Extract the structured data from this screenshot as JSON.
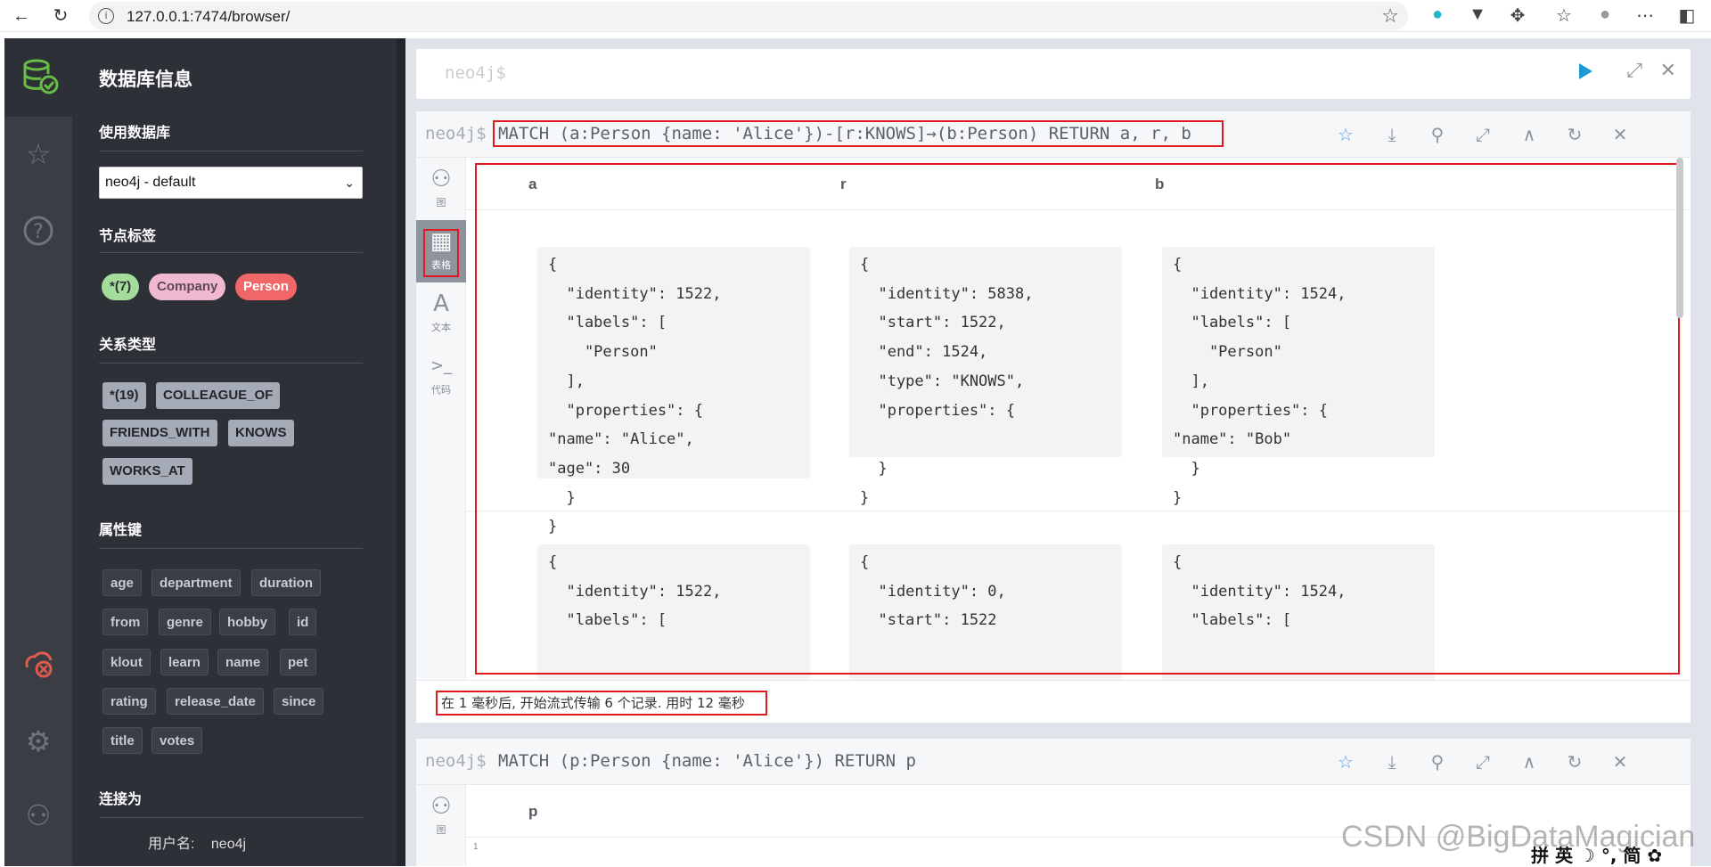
{
  "browser": {
    "url": "127.0.0.1:7474/browser/",
    "info_glyph": "i"
  },
  "sidebar": {
    "title": "数据库信息",
    "use_db_heading": "使用数据库",
    "db_select_value": "neo4j - default",
    "node_labels_heading": "节点标签",
    "node_labels": [
      {
        "label": "*(7)",
        "color": "#a4dd9b",
        "text_color": "#2d3037"
      },
      {
        "label": "Company",
        "color": "#f1b9cf",
        "text_color": "#604a55"
      },
      {
        "label": "Person",
        "color": "#f16667",
        "text_color": "#ffffff"
      }
    ],
    "rel_types_heading": "关系类型",
    "rel_types": [
      "*(19)",
      "COLLEAGUE_OF",
      "FRIENDS_WITH",
      "KNOWS",
      "WORKS_AT"
    ],
    "prop_keys_heading": "属性键",
    "prop_keys": [
      "age",
      "department",
      "duration",
      "from",
      "genre",
      "hobby",
      "id",
      "klout",
      "learn",
      "name",
      "pet",
      "rating",
      "release_date",
      "since",
      "title",
      "votes"
    ],
    "connected_heading": "连接为",
    "username_label": "用户名:",
    "username_value": "neo4j"
  },
  "editor": {
    "prompt": "neo4j$"
  },
  "frame1": {
    "prompt": "neo4j$",
    "query": "MATCH (a:Person {name: 'Alice'})-[r:KNOWS]→(b:Person) RETURN a, r, b",
    "side": [
      {
        "icon": "graph-icon",
        "glyph": "⚇",
        "label": "图"
      },
      {
        "icon": "table-icon",
        "glyph": "▦",
        "label": "表格"
      },
      {
        "icon": "text-icon",
        "glyph": "A",
        "label": "文本"
      },
      {
        "icon": "code-icon",
        "glyph": ">_",
        "label": "代码"
      }
    ],
    "columns": [
      "a",
      "r",
      "b"
    ],
    "row1": {
      "a": "{\n  \"identity\": 1522,\n  \"labels\": [\n    \"Person\"\n  ],\n  \"properties\": {\n\"name\": \"Alice\",\n\"age\": 30\n  }\n}",
      "r": "{\n  \"identity\": 5838,\n  \"start\": 1522,\n  \"end\": 1524,\n  \"type\": \"KNOWS\",\n  \"properties\": {\n\n  }\n}",
      "b": "{\n  \"identity\": 1524,\n  \"labels\": [\n    \"Person\"\n  ],\n  \"properties\": {\n\"name\": \"Bob\"\n  }\n}"
    },
    "row2": {
      "a": "{\n  \"identity\": 1522,\n  \"labels\": [",
      "r": "{\n  \"identity\": 0,\n  \"start\": 1522",
      "b": "{\n  \"identity\": 1524,\n  \"labels\": ["
    },
    "status": "在 1 毫秒后, 开始流式传输 6 个记录. 用时 12 毫秒"
  },
  "frame2": {
    "prompt": "neo4j$",
    "query": "MATCH (p:Person {name: 'Alice'}) RETURN p",
    "column": "p",
    "side_label": "图",
    "row_marker": "1"
  },
  "watermark": "CSDN @BigDataMagician",
  "ime": "拼 英 ☽ °, 简 ✿"
}
